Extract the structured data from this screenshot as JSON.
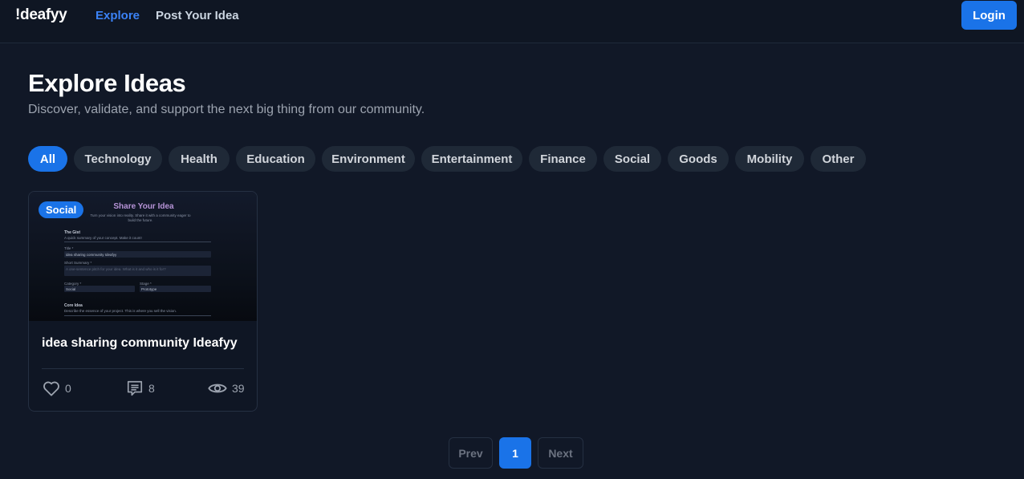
{
  "nav": {
    "logo": "!deafyy",
    "links": [
      {
        "label": "Explore",
        "active": true
      },
      {
        "label": "Post Your Idea",
        "active": false
      }
    ],
    "login_label": "Login"
  },
  "header": {
    "title": "Explore Ideas",
    "subtitle": "Discover, validate, and support the next big thing from our community."
  },
  "categories": [
    {
      "label": "All",
      "active": true
    },
    {
      "label": "Technology",
      "active": false
    },
    {
      "label": "Health",
      "active": false
    },
    {
      "label": "Education",
      "active": false
    },
    {
      "label": "Environment",
      "active": false
    },
    {
      "label": "Entertainment",
      "active": false
    },
    {
      "label": "Finance",
      "active": false
    },
    {
      "label": "Social",
      "active": false
    },
    {
      "label": "Goods",
      "active": false
    },
    {
      "label": "Mobility",
      "active": false
    },
    {
      "label": "Other",
      "active": false
    }
  ],
  "ideas": [
    {
      "category_badge": "Social",
      "title": "idea sharing community Ideafyy",
      "likes": "0",
      "comments": "8",
      "views": "39",
      "thumbnail": {
        "heading": "Share Your Idea",
        "tagline": "Turn your vision into reality. Share it with a community eager to build the future.",
        "section1": "The Gist",
        "section1_desc": "A quick summary of your concept. Make it count!",
        "title_label": "Title *",
        "title_value": "idea sharing community Ideafyy",
        "summary_label": "Short Summary *",
        "summary_placeholder": "A one-sentence pitch for your idea. What is it and who is it for?",
        "category_label": "Category *",
        "category_value": "Social",
        "stage_label": "Stage *",
        "stage_value": "Prototype",
        "section2": "Core Idea",
        "section2_desc": "Describe the essence of your project. This is where you sell the vision."
      }
    }
  ],
  "pagination": {
    "prev_label": "Prev",
    "current_page": "1",
    "next_label": "Next"
  },
  "colors": {
    "background": "#111827",
    "accent": "#1a73e8",
    "chip": "#1f2937",
    "card": "#0f1624"
  }
}
